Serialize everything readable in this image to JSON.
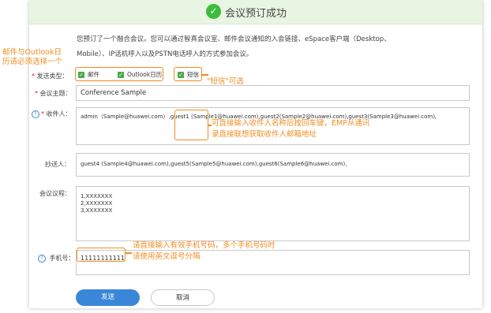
{
  "header": {
    "title": "会议预订成功"
  },
  "intro": {
    "line1": "您预订了一个融合会议。您可以通过智真会议室、邮件会议通知的入会链接、eSpace客户端（Desktop、",
    "line2": "Mobile）、IP话机呼入以及PSTN电话呼入的方式参加会议。"
  },
  "form": {
    "send_type": {
      "label": "发送类型：",
      "options": [
        "邮件",
        "Outlook日历",
        "短信"
      ]
    },
    "subject": {
      "label": "会议主题：",
      "value": "Conference Sample"
    },
    "recipients": {
      "label": "收件人：",
      "value": "admin（Sample@huawei.com）,guest1 (Sample1@huawei.com),guest2(Sample2@huawei.com),guest3(Sample3@huawei.com),"
    },
    "cc": {
      "label": "抄送人：",
      "value": "guest4 (Sample4@huawei.com),guest5(Sample5@huawei.com),guest6(Sample6@huawei.com),"
    },
    "agenda": {
      "label": "会议议程：",
      "lines": [
        "1,XXXXXXX",
        "2,XXXXXXX",
        "3,XXXXXXX"
      ]
    },
    "phone": {
      "label": "手机号：",
      "value": "11111111111"
    }
  },
  "buttons": {
    "send": "发送",
    "cancel": "取消"
  },
  "annotations": {
    "left_note_l1": "邮件与Outlook日",
    "left_note_l2": "历请必须选择一个",
    "sms_note": "\"短信\"可选",
    "recipient_note_l1": "可直接输入收件人名称后按回车键，EMP从通讯",
    "recipient_note_l2": "录直接联想获取收件人邮箱地址",
    "phone_note_l1": "请直接输入有效手机号码，多个手机号码时",
    "phone_note_l2": "请使用英文逗号分隔"
  },
  "colors": {
    "accent": "#3a87d9",
    "success": "#3dbd3d",
    "annotation": "#f08c1e",
    "required": "#e02020"
  }
}
